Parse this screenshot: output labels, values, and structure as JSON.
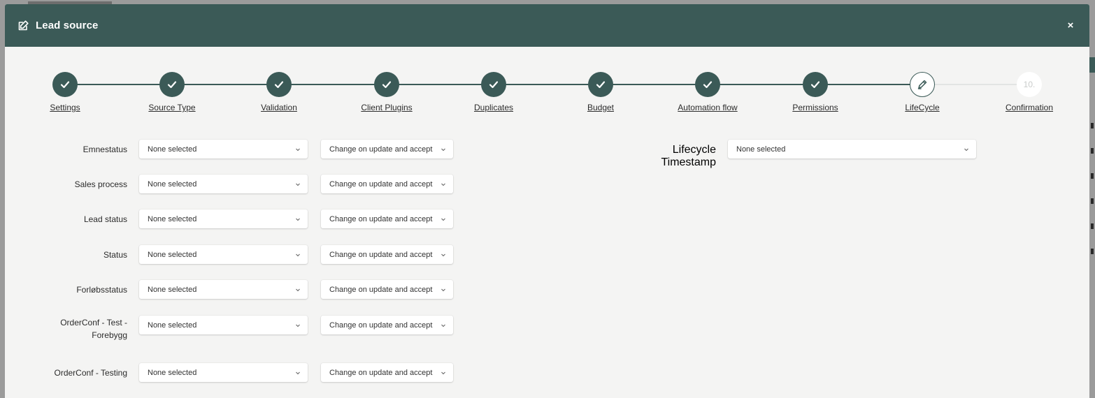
{
  "modal": {
    "title": "Lead source",
    "close_label": "×"
  },
  "steps": [
    {
      "label": "Settings",
      "state": "done"
    },
    {
      "label": "Source Type",
      "state": "done"
    },
    {
      "label": "Validation",
      "state": "done"
    },
    {
      "label": "Client Plugins",
      "state": "done"
    },
    {
      "label": "Duplicates",
      "state": "done"
    },
    {
      "label": "Budget",
      "state": "done"
    },
    {
      "label": "Automation flow",
      "state": "done"
    },
    {
      "label": "Permissions",
      "state": "done"
    },
    {
      "label": "LifeCycle",
      "state": "current"
    },
    {
      "label": "Confirmation",
      "state": "todo",
      "number": "10."
    }
  ],
  "fields": [
    {
      "label": "Emnestatus",
      "value": "None selected",
      "mode": "Change on update and accept"
    },
    {
      "label": "Sales process",
      "value": "None selected",
      "mode": "Change on update and accept"
    },
    {
      "label": "Lead status",
      "value": "None selected",
      "mode": "Change on update and accept"
    },
    {
      "label": "Status",
      "value": "None selected",
      "mode": "Change on update and accept"
    },
    {
      "label": "Forløbsstatus",
      "value": "None selected",
      "mode": "Change on update and accept"
    },
    {
      "label": "OrderConf - Test - Forebygg",
      "value": "None selected",
      "mode": "Change on update and accept"
    },
    {
      "label": "OrderConf - Testing",
      "value": "None selected",
      "mode": "Change on update and accept"
    }
  ],
  "lifecycle_timestamp": {
    "label": "Lifecycle Timestamp",
    "value": "None selected"
  },
  "colors": {
    "header": "#3b5a57",
    "background": "#f4f4f3"
  }
}
